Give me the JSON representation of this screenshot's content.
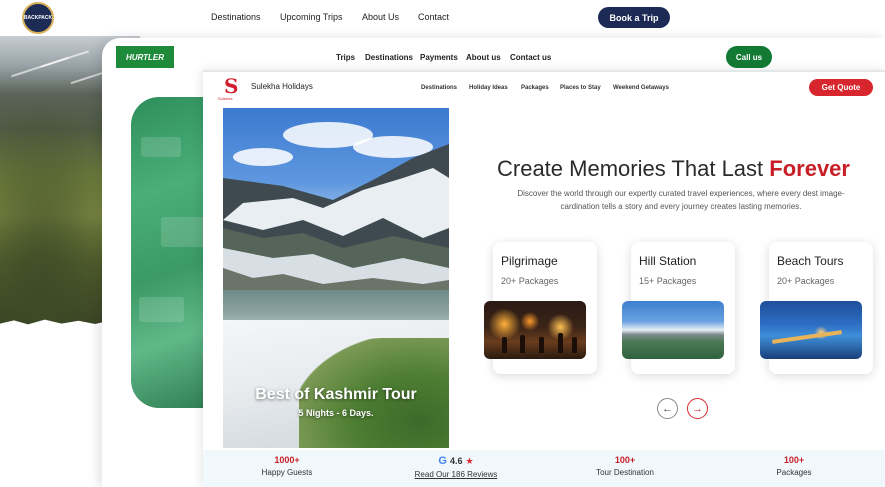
{
  "backpack": {
    "logo_text": "BACKPACK",
    "nav": [
      "Destinations",
      "Upcoming Trips",
      "About Us",
      "Contact"
    ],
    "cta": "Book a Trip"
  },
  "hurtler": {
    "logo_text": "HURTLER",
    "nav": [
      "Trips",
      "Destinations",
      "Payments",
      "About us",
      "Contact us"
    ],
    "cta": "Call us"
  },
  "sulekha": {
    "logo_glyph": "S",
    "logo_sub": "Sulekha",
    "brand": "Sulekha Holidays",
    "nav": [
      "Destinations",
      "Holiday Ideas",
      "Packages",
      "Places to Stay",
      "Weekend Getaways"
    ],
    "cta": "Get Quote",
    "hero": {
      "title": "Best of Kashmir Tour",
      "subtitle": "5 Nights - 6 Days."
    },
    "headline": {
      "main": "Create Memories That Last ",
      "accent": "Forever"
    },
    "description": "Discover the world through our expertly curated travel experiences, where every dest image-cardination tells a story and every journey creates lasting memories.",
    "categories": [
      {
        "title": "Pilgrimage",
        "count": "20+ Packages"
      },
      {
        "title": "Hill Station",
        "count": "15+ Packages"
      },
      {
        "title": "Beach Tours",
        "count": "20+ Packages"
      }
    ],
    "prev_glyph": "←",
    "next_glyph": "→",
    "stats": {
      "guests_value": "1000+",
      "guests_label": "Happy Guests",
      "rating_logo": "G",
      "rating_value": "4.6",
      "rating_star": "★",
      "reviews_label": "Read Our 186 Reviews",
      "destinations_value": "100+",
      "destinations_label": "Tour Destination",
      "packages_value": "100+",
      "packages_label": "Packages"
    }
  },
  "colors": {
    "backpack_navy": "#1c2a55",
    "hurtler_green": "#137a34",
    "sulekha_red": "#d8262e",
    "accent_red": "#c81e25",
    "stats_bg": "#f0f8fb"
  }
}
